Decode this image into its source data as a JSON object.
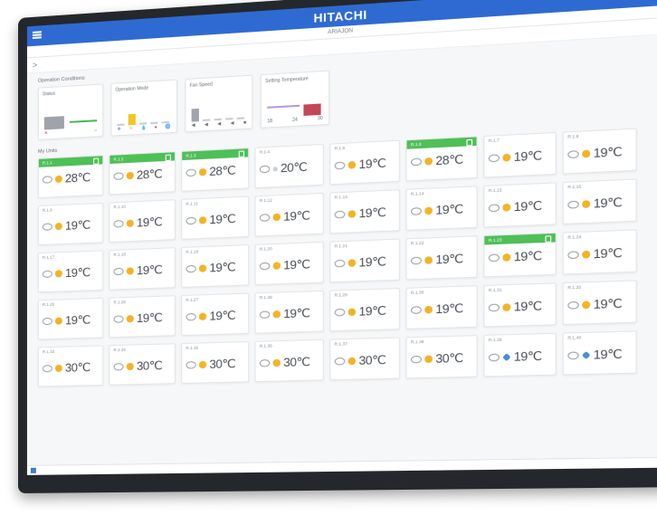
{
  "app": {
    "brand": "HITACHI",
    "page_title": "ARIAJON"
  },
  "operation": {
    "section_title": "Operation Conditions",
    "cards": [
      {
        "label": "Status",
        "ticks": [
          "✕",
          "○"
        ]
      },
      {
        "label": "Operation Mode",
        "ticks": [
          "❄",
          "☀",
          "💧",
          "●",
          "🌀"
        ]
      },
      {
        "label": "Fan Speed",
        "ticks": [
          "◀",
          "◀",
          "◀",
          "◀",
          "■"
        ]
      },
      {
        "label": "Setting Temperature",
        "ticks": [
          "18",
          "24",
          "30"
        ]
      }
    ]
  },
  "units": {
    "section_title": "My Units",
    "items": [
      {
        "name": "R.1.1",
        "active": true,
        "mode": "heat",
        "temp": "28℃"
      },
      {
        "name": "R.1.2",
        "active": true,
        "mode": "heat",
        "temp": "28℃"
      },
      {
        "name": "R.1.3",
        "active": true,
        "mode": "heat",
        "temp": "28℃"
      },
      {
        "name": "R.1.4",
        "active": false,
        "mode": "dry",
        "temp": "20℃"
      },
      {
        "name": "R.1.5",
        "active": false,
        "mode": "heat",
        "temp": "19℃"
      },
      {
        "name": "R.1.6",
        "active": true,
        "mode": "heat",
        "temp": "28℃"
      },
      {
        "name": "R.1.7",
        "active": false,
        "mode": "heat",
        "temp": "19℃"
      },
      {
        "name": "R.1.8",
        "active": false,
        "mode": "heat",
        "temp": "19℃"
      },
      {
        "name": "R.1.9",
        "active": false,
        "mode": "heat",
        "temp": "19℃"
      },
      {
        "name": "R.1.10",
        "active": false,
        "mode": "heat",
        "temp": "19℃"
      },
      {
        "name": "R.1.11",
        "active": false,
        "mode": "heat",
        "temp": "19℃"
      },
      {
        "name": "R.1.12",
        "active": false,
        "mode": "heat",
        "temp": "19℃"
      },
      {
        "name": "R.1.13",
        "active": false,
        "mode": "heat",
        "temp": "19℃"
      },
      {
        "name": "R.1.14",
        "active": false,
        "mode": "heat",
        "temp": "19℃"
      },
      {
        "name": "R.1.15",
        "active": false,
        "mode": "heat",
        "temp": "19℃"
      },
      {
        "name": "R.1.16",
        "active": false,
        "mode": "heat",
        "temp": "19℃"
      },
      {
        "name": "R.1.17",
        "active": false,
        "mode": "heat",
        "temp": "19℃"
      },
      {
        "name": "R.1.18",
        "active": false,
        "mode": "heat",
        "temp": "19℃"
      },
      {
        "name": "R.1.19",
        "active": false,
        "mode": "heat",
        "temp": "19℃"
      },
      {
        "name": "R.1.20",
        "active": false,
        "mode": "heat",
        "temp": "19℃"
      },
      {
        "name": "R.1.21",
        "active": false,
        "mode": "heat",
        "temp": "19℃"
      },
      {
        "name": "R.1.22",
        "active": false,
        "mode": "heat",
        "temp": "19℃"
      },
      {
        "name": "R.1.23",
        "active": true,
        "mode": "heat",
        "temp": "19℃"
      },
      {
        "name": "R.1.24",
        "active": false,
        "mode": "heat",
        "temp": "19℃"
      },
      {
        "name": "R.1.25",
        "active": false,
        "mode": "heat",
        "temp": "19℃"
      },
      {
        "name": "R.1.26",
        "active": false,
        "mode": "heat",
        "temp": "19℃"
      },
      {
        "name": "R.1.27",
        "active": false,
        "mode": "heat",
        "temp": "19℃"
      },
      {
        "name": "R.1.28",
        "active": false,
        "mode": "heat",
        "temp": "19℃"
      },
      {
        "name": "R.1.29",
        "active": false,
        "mode": "heat",
        "temp": "19℃"
      },
      {
        "name": "R.1.30",
        "active": false,
        "mode": "heat",
        "temp": "19℃"
      },
      {
        "name": "R.1.31",
        "active": false,
        "mode": "heat",
        "temp": "19℃"
      },
      {
        "name": "R.1.32",
        "active": false,
        "mode": "heat",
        "temp": "19℃"
      },
      {
        "name": "R.1.33",
        "active": false,
        "mode": "heat",
        "temp": "30℃"
      },
      {
        "name": "R.1.34",
        "active": false,
        "mode": "heat",
        "temp": "30℃"
      },
      {
        "name": "R.1.35",
        "active": false,
        "mode": "heat",
        "temp": "30℃"
      },
      {
        "name": "R.1.36",
        "active": false,
        "mode": "heat",
        "temp": "30℃"
      },
      {
        "name": "R.1.37",
        "active": false,
        "mode": "heat",
        "temp": "30℃"
      },
      {
        "name": "R.1.38",
        "active": false,
        "mode": "heat",
        "temp": "30℃"
      },
      {
        "name": "R.1.39",
        "active": false,
        "mode": "cool",
        "temp": "19℃"
      },
      {
        "name": "R.1.40",
        "active": false,
        "mode": "cool",
        "temp": "19℃"
      }
    ]
  },
  "colors": {
    "header": "#2f6ad3",
    "active_unit": "#4fbf58",
    "heat": "#f4b324",
    "cool": "#4d8ad8"
  }
}
